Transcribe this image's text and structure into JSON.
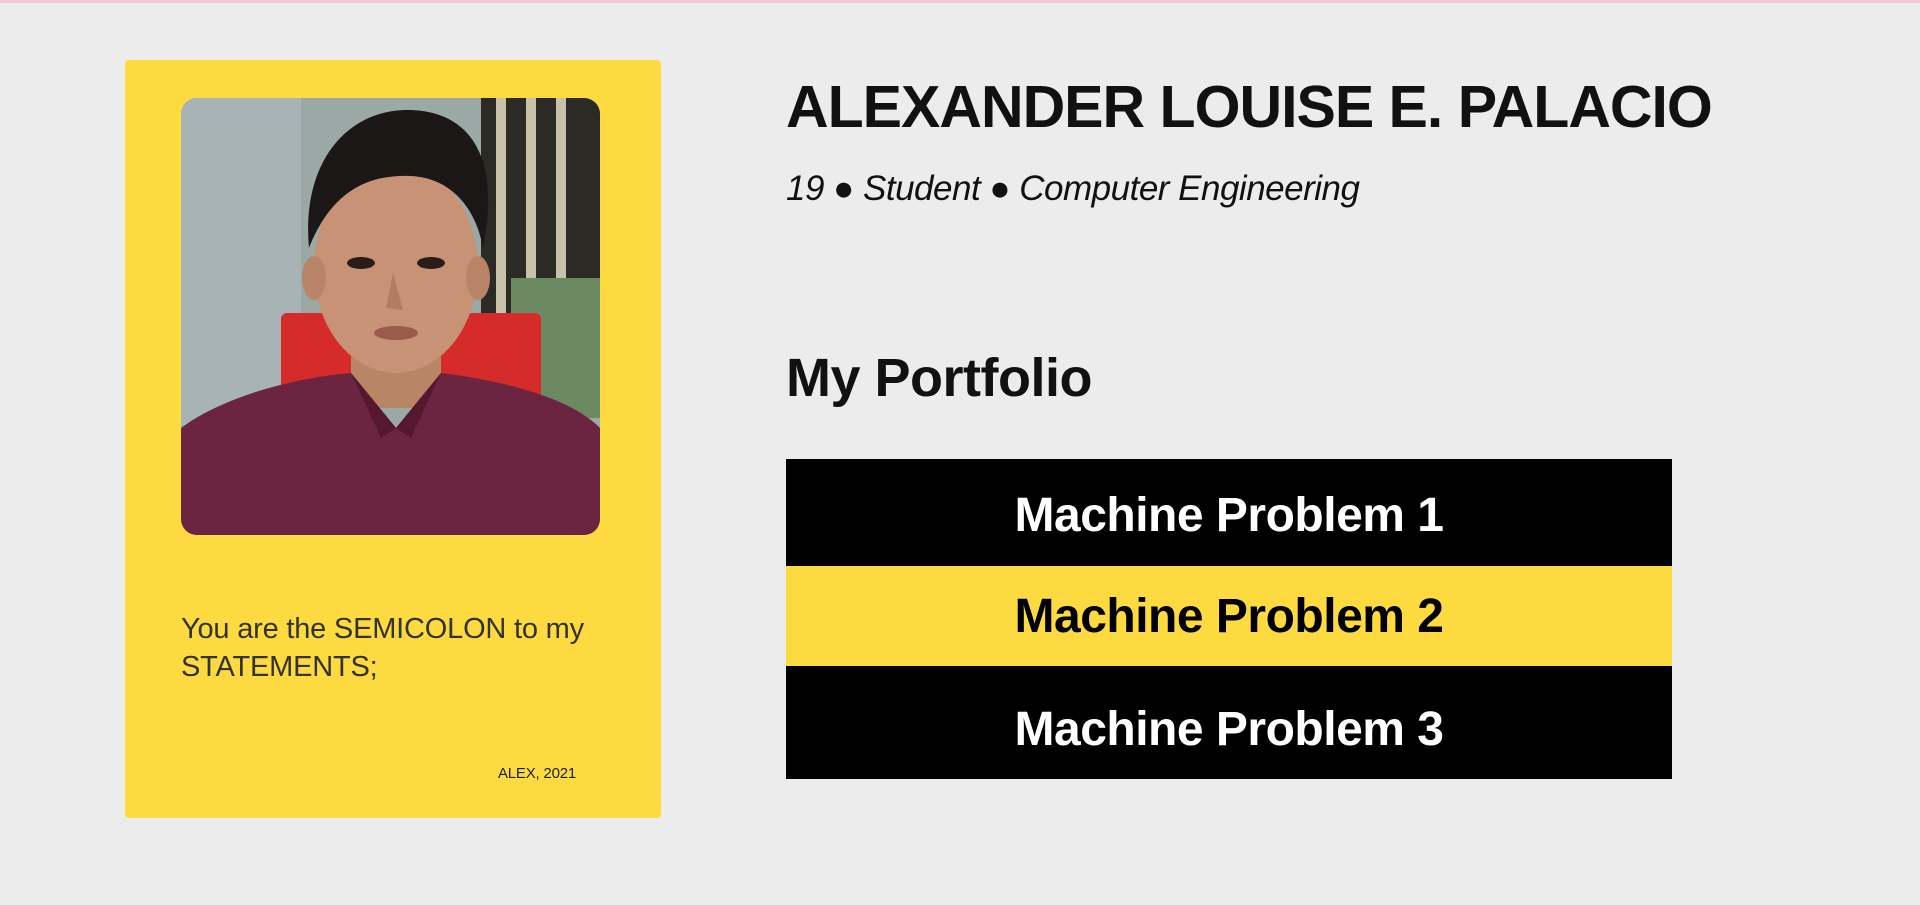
{
  "colors": {
    "background": "#ececec",
    "accent_yellow": "#fdda3f",
    "dark": "#000000",
    "text": "#111111"
  },
  "profile": {
    "photo_icon": "profile-photo",
    "quote_line_1": "You are the SEMICOLON to my",
    "quote_line_2": "STATEMENTS;",
    "quote_credit": "ALEX, 2021"
  },
  "header": {
    "name": "ALEXANDER LOUISE E. PALACIO",
    "tagline": "19 ● Student ● Computer Engineering"
  },
  "portfolio": {
    "title": "My Portfolio",
    "items": [
      {
        "label": "Machine Problem 1"
      },
      {
        "label": "Machine Problem 2"
      },
      {
        "label": "Machine Problem 3"
      }
    ]
  }
}
